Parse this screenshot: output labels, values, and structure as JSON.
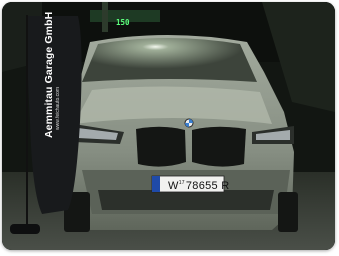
{
  "banner": {
    "title": "Aemmitau Garage GmbH",
    "website": "www.feichauto.com"
  },
  "price_sign": {
    "value": "150"
  },
  "license_plate": {
    "prefix": "W",
    "small_text": "17",
    "number": "78655 R"
  },
  "colors": {
    "car_body": "#8e9689",
    "night_sky": "#111512",
    "banner": "#181a1c",
    "sign_green": "#5cff7d"
  },
  "icons": [
    "kidney-grille-icon",
    "bmw-logo-icon"
  ]
}
